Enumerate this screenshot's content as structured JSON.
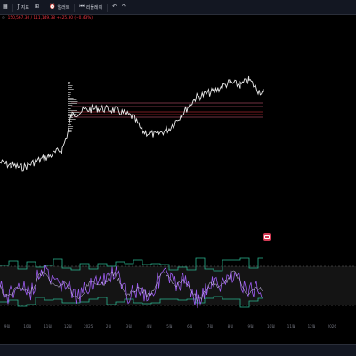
{
  "toolbar": {
    "indicators_label": "지표",
    "alert_label": "얼러트",
    "replay_label": "리플레이"
  },
  "legend": {
    "values": "150,567.30 / 111,149.38 +425.30 (+0.43%)"
  },
  "colors": {
    "price": "#f0f0f0",
    "osc": "#9c5cf0",
    "band": "#2ab58f",
    "level_pink": "#e0607e",
    "level_red": "#f23645"
  },
  "x_axis": {
    "ticks": [
      "9월",
      "10월",
      "11월",
      "12월",
      "2025",
      "2월",
      "3월",
      "4월",
      "5월",
      "6월",
      "7월",
      "8월",
      "9월",
      "10월",
      "11월",
      "12월",
      "2026"
    ]
  }
}
